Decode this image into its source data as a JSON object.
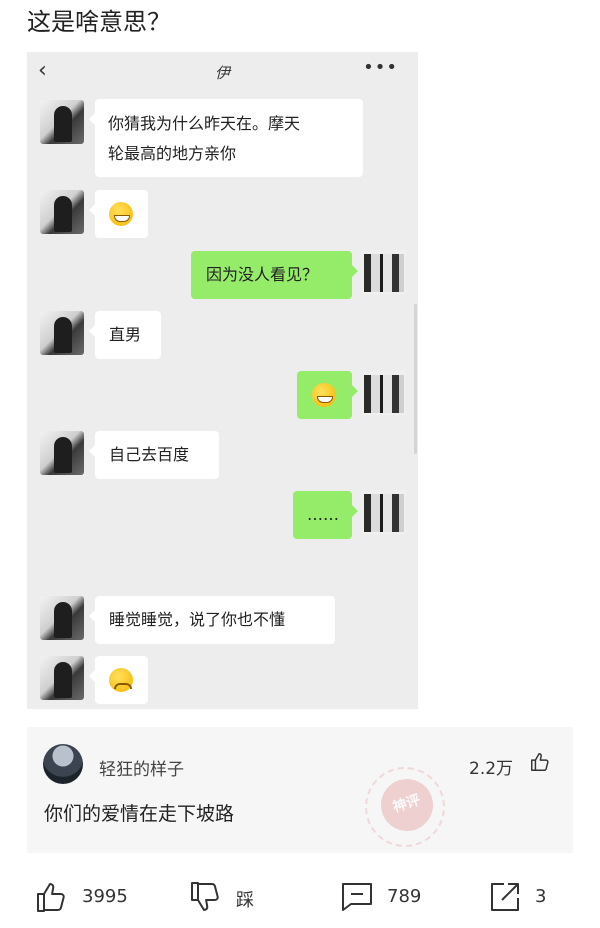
{
  "post": {
    "title": "这是啥意思？"
  },
  "chat": {
    "contact_name": "伊",
    "back_icon": "chevron-left-icon",
    "more_icon": "more-dots-icon",
    "messages": [
      {
        "side": "in",
        "lines": [
          "你猜我为什么昨天在。摩天",
          "轮最高的地方亲你"
        ]
      },
      {
        "side": "in",
        "emoji": "grinning-emoji"
      },
      {
        "side": "out",
        "text": "因为没人看见？"
      },
      {
        "side": "in",
        "text": "直男"
      },
      {
        "side": "out",
        "emoji": "laughing-tears-emoji"
      },
      {
        "side": "in",
        "text": "自己去百度"
      },
      {
        "side": "out",
        "text": "……"
      },
      {
        "side": "in",
        "text": "睡觉睡觉，说了你也不懂"
      },
      {
        "side": "in",
        "emoji": "sad-emoji"
      }
    ]
  },
  "comment": {
    "username": "轻狂的样子",
    "likes": "2.2万",
    "text": "你们的爱情在走下坡路",
    "stamp_text": "神评"
  },
  "actions": {
    "like_count": "3995",
    "dislike_label": "踩",
    "comment_count": "789",
    "share_count": "3"
  },
  "colors": {
    "outgoing_bubble": "#95ec69",
    "chat_background": "#ededed"
  }
}
